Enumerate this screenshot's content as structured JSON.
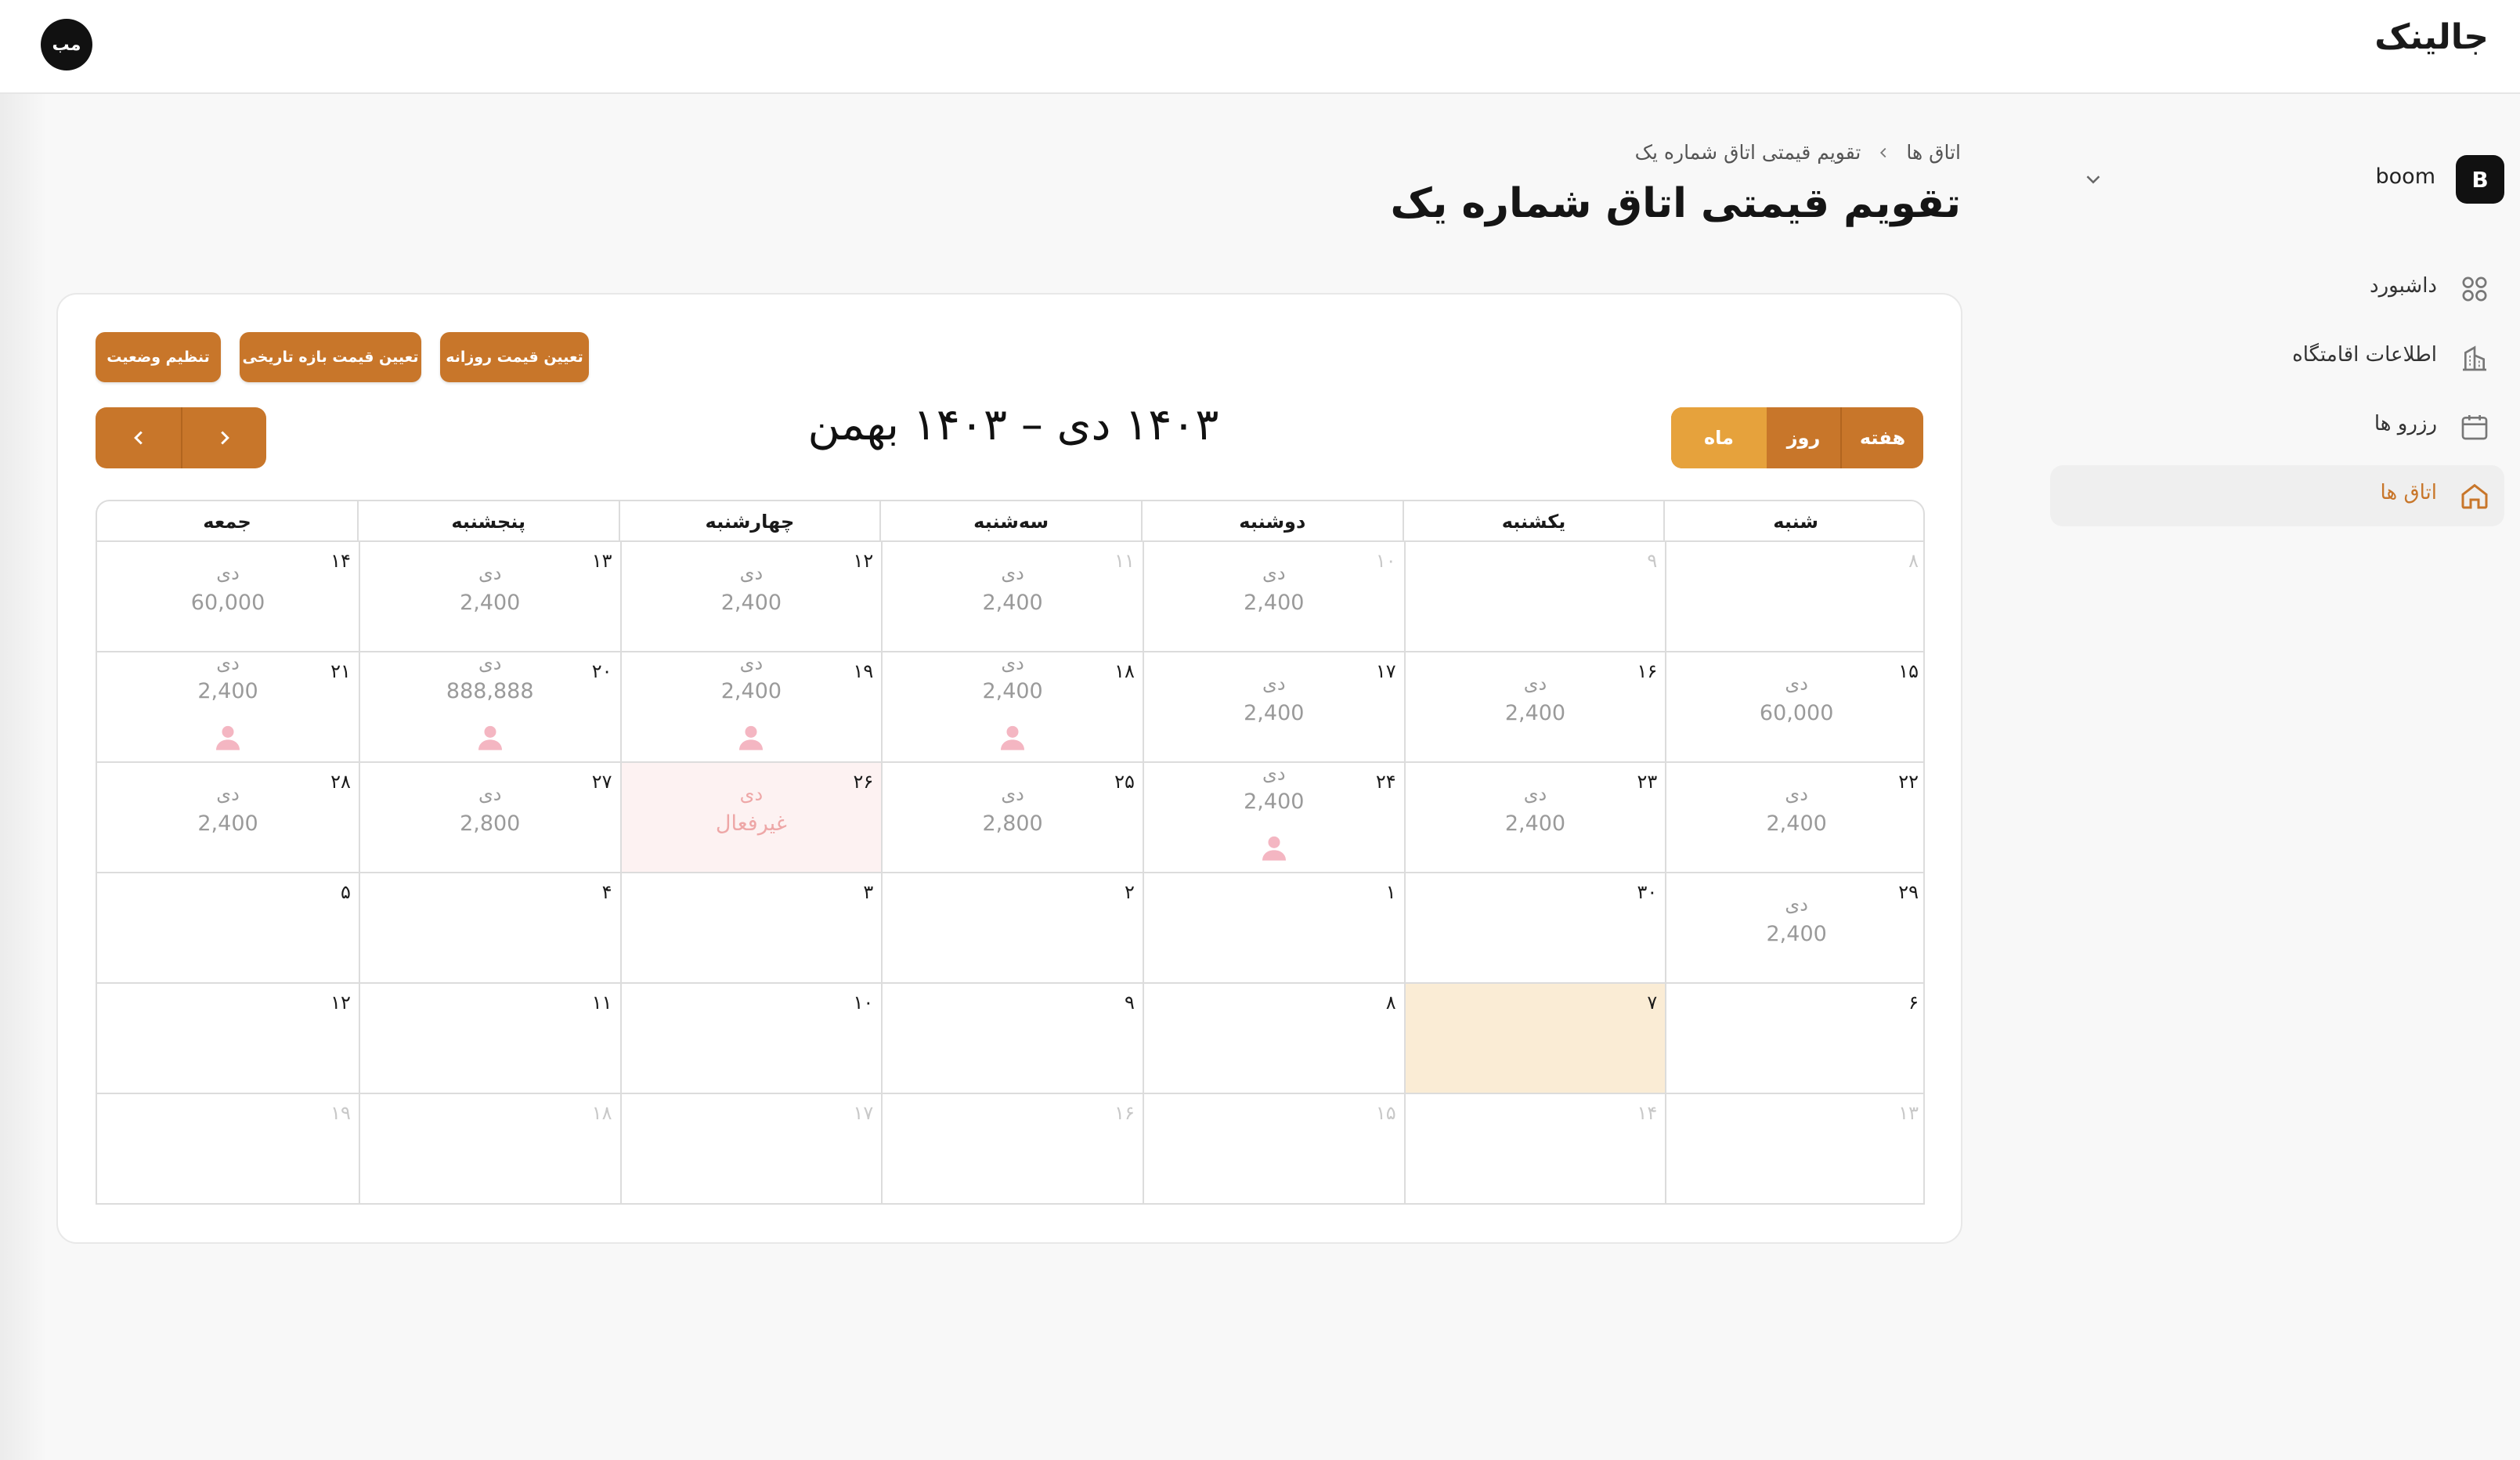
{
  "header": {
    "brand": "جالینک",
    "user_initials": "مب"
  },
  "sidebar": {
    "account": {
      "initial": "B",
      "name": "boom"
    },
    "items": [
      {
        "label": "داشبورد",
        "icon": "grid-icon",
        "active": false
      },
      {
        "label": "اطلاعات اقامتگاه",
        "icon": "building-icon",
        "active": false
      },
      {
        "label": "رزرو ها",
        "icon": "calendar-icon",
        "active": false
      },
      {
        "label": "اتاق ها",
        "icon": "home-icon",
        "active": true
      }
    ]
  },
  "breadcrumb": {
    "parent": "اتاق ها",
    "current": "تقویم قیمتی اتاق شماره یک"
  },
  "page_title": "تقویم قیمتی اتاق شماره یک",
  "actions": {
    "daily_price": "تعیین قیمت روزانه",
    "range_price": "تعیین قیمت بازه تاریخی",
    "set_status": "تنظیم وضعیت"
  },
  "calendar": {
    "range_title": "۱۴۰۳ دی – ۱۴۰۳ بهمن",
    "views": {
      "week": "هفته",
      "day": "روز",
      "month": "ماه"
    },
    "active_view": "month",
    "weekdays": [
      "شنبه",
      "یکشنبه",
      "دوشنبه",
      "سه‌شنبه",
      "چهارشنبه",
      "پنجشنبه",
      "جمعه"
    ],
    "month_label": "دی",
    "disabled_label": "غیرفعال",
    "colors": {
      "accent": "#c8762a",
      "active_view": "#e6a23c",
      "today_bg": "#faecd5",
      "disabled_bg": "#fdf2f2",
      "guest_icon": "#f4b6c2"
    },
    "cells": [
      {
        "day": "۸",
        "muted": true
      },
      {
        "day": "۹",
        "muted": true
      },
      {
        "day": "۱۰",
        "muted": true,
        "month": "دی",
        "price": "2,400"
      },
      {
        "day": "۱۱",
        "muted": true,
        "month": "دی",
        "price": "2,400"
      },
      {
        "day": "۱۲",
        "month": "دی",
        "price": "2,400"
      },
      {
        "day": "۱۳",
        "month": "دی",
        "price": "2,400"
      },
      {
        "day": "۱۴",
        "month": "دی",
        "price": "60,000"
      },
      {
        "day": "۱۵",
        "month": "دی",
        "price": "60,000"
      },
      {
        "day": "۱۶",
        "month": "دی",
        "price": "2,400"
      },
      {
        "day": "۱۷",
        "month": "دی",
        "price": "2,400"
      },
      {
        "day": "۱۸",
        "month": "دی",
        "price": "2,400",
        "guest": true
      },
      {
        "day": "۱۹",
        "month": "دی",
        "price": "2,400",
        "guest": true
      },
      {
        "day": "۲۰",
        "month": "دی",
        "price": "888,888",
        "guest": true
      },
      {
        "day": "۲۱",
        "month": "دی",
        "price": "2,400",
        "guest": true
      },
      {
        "day": "۲۲",
        "month": "دی",
        "price": "2,400"
      },
      {
        "day": "۲۳",
        "month": "دی",
        "price": "2,400"
      },
      {
        "day": "۲۴",
        "month": "دی",
        "price": "2,400",
        "guest": true
      },
      {
        "day": "۲۵",
        "month": "دی",
        "price": "2,800"
      },
      {
        "day": "۲۶",
        "month": "دی",
        "price": "غیرفعال",
        "disabled": true
      },
      {
        "day": "۲۷",
        "month": "دی",
        "price": "2,800"
      },
      {
        "day": "۲۸",
        "month": "دی",
        "price": "2,400"
      },
      {
        "day": "۲۹",
        "month": "دی",
        "price": "2,400"
      },
      {
        "day": "۳۰"
      },
      {
        "day": "۱"
      },
      {
        "day": "۲"
      },
      {
        "day": "۳"
      },
      {
        "day": "۴"
      },
      {
        "day": "۵"
      },
      {
        "day": "۶"
      },
      {
        "day": "۷",
        "today": true
      },
      {
        "day": "۸"
      },
      {
        "day": "۹"
      },
      {
        "day": "۱۰"
      },
      {
        "day": "۱۱"
      },
      {
        "day": "۱۲"
      },
      {
        "day": "۱۳",
        "muted": true
      },
      {
        "day": "۱۴",
        "muted": true
      },
      {
        "day": "۱۵",
        "muted": true
      },
      {
        "day": "۱۶",
        "muted": true
      },
      {
        "day": "۱۷",
        "muted": true
      },
      {
        "day": "۱۸",
        "muted": true
      },
      {
        "day": "۱۹",
        "muted": true
      }
    ]
  }
}
